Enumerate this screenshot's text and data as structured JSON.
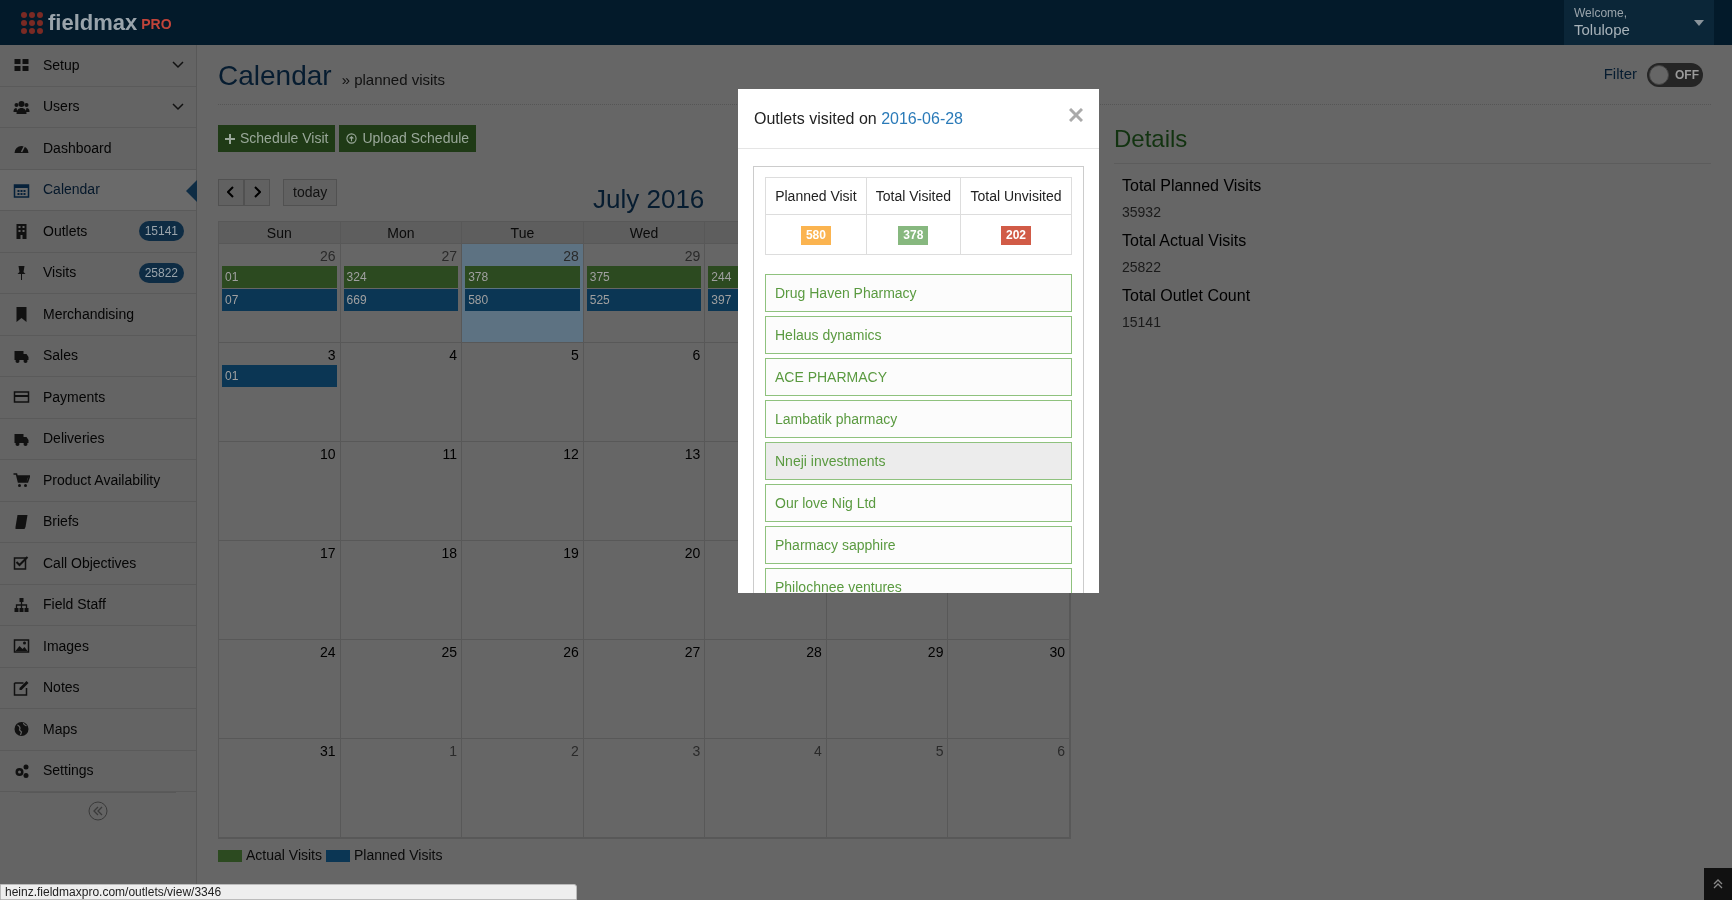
{
  "header": {
    "logo_text": "fieldmax",
    "logo_suffix": "PRO",
    "welcome": "Welcome,",
    "user": "Tolulope"
  },
  "sidebar": {
    "items": [
      {
        "label": "Setup",
        "expandable": true,
        "selected": false
      },
      {
        "label": "Users",
        "expandable": true,
        "selected": false
      },
      {
        "label": "Dashboard",
        "expandable": false,
        "selected": false
      },
      {
        "label": "Calendar",
        "expandable": false,
        "selected": true
      },
      {
        "label": "Outlets",
        "expandable": false,
        "selected": false,
        "badge": "15141"
      },
      {
        "label": "Visits",
        "expandable": false,
        "selected": false,
        "badge": "25822"
      },
      {
        "label": "Merchandising",
        "expandable": false,
        "selected": false
      },
      {
        "label": "Sales",
        "expandable": false,
        "selected": false
      },
      {
        "label": "Payments",
        "expandable": false,
        "selected": false
      },
      {
        "label": "Deliveries",
        "expandable": false,
        "selected": false
      },
      {
        "label": "Product Availability",
        "expandable": false,
        "selected": false
      },
      {
        "label": "Briefs",
        "expandable": false,
        "selected": false
      },
      {
        "label": "Call Objectives",
        "expandable": false,
        "selected": false
      },
      {
        "label": "Field Staff",
        "expandable": false,
        "selected": false
      },
      {
        "label": "Images",
        "expandable": false,
        "selected": false
      },
      {
        "label": "Notes",
        "expandable": false,
        "selected": false
      },
      {
        "label": "Maps",
        "expandable": false,
        "selected": false
      },
      {
        "label": "Settings",
        "expandable": false,
        "selected": false
      }
    ]
  },
  "page": {
    "title": "Calendar",
    "breadcrumb": "» planned visits",
    "filter_label": "Filter",
    "filter_toggle": {
      "on": false,
      "label": "OFF"
    }
  },
  "actions": [
    "Schedule Visit",
    "Upload Schedule"
  ],
  "calendar": {
    "title": "July 2016",
    "today_label": "today",
    "weekdays": [
      "Sun",
      "Mon",
      "Tue",
      "Wed"
    ],
    "weeks": [
      {
        "days": [
          {
            "day": "26",
            "other_month": true,
            "highlighted": false,
            "events": [
              {
                "kind": "actual",
                "value": "01"
              },
              {
                "kind": "planned",
                "value": "07"
              }
            ]
          },
          {
            "day": "27",
            "other_month": true,
            "highlighted": false,
            "events": [
              {
                "kind": "actual",
                "value": "324"
              },
              {
                "kind": "planned",
                "value": "669"
              }
            ]
          },
          {
            "day": "28",
            "other_month": true,
            "highlighted": true,
            "events": [
              {
                "kind": "actual",
                "value": "378"
              },
              {
                "kind": "planned",
                "value": "580"
              }
            ]
          },
          {
            "day": "29",
            "other_month": true,
            "highlighted": false,
            "events": [
              {
                "kind": "actual",
                "value": "375"
              },
              {
                "kind": "planned",
                "value": "525"
              }
            ]
          },
          {
            "highlighted": false,
            "events": [
              {
                "kind": "actual",
                "value": "244"
              },
              {
                "kind": "planned",
                "value": "397"
              }
            ]
          }
        ]
      },
      {
        "days": [
          {
            "day": "3",
            "other_month": false,
            "highlighted": false,
            "events": [
              {
                "kind": "planned",
                "value": "01"
              }
            ]
          },
          {
            "day": "4",
            "other_month": false,
            "highlighted": false
          },
          {
            "day": "5",
            "other_month": false,
            "highlighted": false
          },
          {
            "day": "6",
            "other_month": false,
            "highlighted": false
          }
        ]
      },
      {
        "days": [
          {
            "day": "10",
            "other_month": false,
            "highlighted": false
          },
          {
            "day": "11",
            "other_month": false,
            "highlighted": false
          },
          {
            "day": "12",
            "other_month": false,
            "highlighted": false
          },
          {
            "day": "13",
            "other_month": false,
            "highlighted": false
          }
        ]
      },
      {
        "days": [
          {
            "day": "17",
            "other_month": false,
            "highlighted": false
          },
          {
            "day": "18",
            "other_month": false,
            "highlighted": false
          },
          {
            "day": "19",
            "other_month": false,
            "highlighted": false
          },
          {
            "day": "20",
            "other_month": false,
            "highlighted": false
          }
        ]
      },
      {
        "days": [
          {
            "day": "24",
            "other_month": false,
            "highlighted": false
          },
          {
            "day": "25",
            "other_month": false,
            "highlighted": false
          },
          {
            "day": "26",
            "other_month": false,
            "highlighted": false
          },
          {
            "day": "27",
            "other_month": false,
            "highlighted": false
          },
          {
            "day": "28",
            "other_month": false,
            "highlighted": false
          },
          {
            "day": "29",
            "other_month": false,
            "highlighted": false
          },
          {
            "day": "30",
            "other_month": false,
            "highlighted": false
          }
        ]
      },
      {
        "days": [
          {
            "day": "31",
            "other_month": false,
            "highlighted": false
          },
          {
            "day": "1",
            "other_month": true,
            "highlighted": false
          },
          {
            "day": "2",
            "other_month": true,
            "highlighted": false
          },
          {
            "day": "3",
            "other_month": true,
            "highlighted": false
          },
          {
            "day": "4",
            "other_month": true,
            "highlighted": false
          },
          {
            "day": "5",
            "other_month": true,
            "highlighted": false
          },
          {
            "day": "6",
            "other_month": true,
            "highlighted": false
          }
        ]
      }
    ]
  },
  "legend": [
    {
      "label": "Actual Visits",
      "color": "#2c4a20"
    },
    {
      "label": "Planned Visits",
      "color": "#0b3654"
    }
  ],
  "details": {
    "title": "Details",
    "stats": [
      {
        "label": "Total Planned Visits",
        "value": "35932"
      },
      {
        "label": "Total Actual Visits",
        "value": "25822"
      },
      {
        "label": "Total Outlet Count",
        "value": "15141"
      }
    ]
  },
  "modal": {
    "title": "Outlets visited on",
    "date": "2016-06-28",
    "summary": [
      {
        "label": "Planned Visit",
        "value": "580",
        "color": "#fbb450"
      },
      {
        "label": "Total Visited",
        "value": "378",
        "color": "#87b87f"
      },
      {
        "label": "Total Unvisited",
        "value": "202",
        "color": "#d15b47"
      }
    ],
    "outlets": [
      {
        "name": "Drug Haven Pharmacy",
        "hovered": false
      },
      {
        "name": "Helaus dynamics",
        "hovered": false
      },
      {
        "name": "ACE PHARMACY",
        "hovered": false
      },
      {
        "name": "Lambatik pharmacy",
        "hovered": false
      },
      {
        "name": "Nneji investments",
        "hovered": true
      },
      {
        "name": "Our love Nig Ltd",
        "hovered": false
      },
      {
        "name": "Pharmacy sapphire",
        "hovered": false
      },
      {
        "name": "Philochnee ventures",
        "hovered": false
      }
    ]
  },
  "status_url": "heinz.fieldmaxpro.com/outlets/view/3346"
}
